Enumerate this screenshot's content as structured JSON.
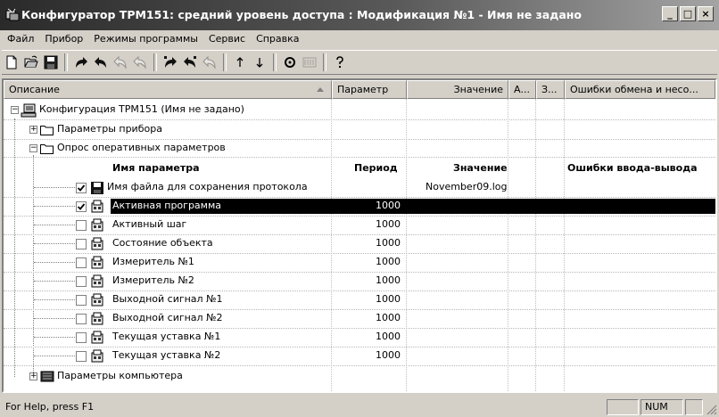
{
  "window": {
    "title": "Конфигуратор ТРМ151: средний уровень доступа : Модификация №1 - Имя не задано",
    "minimize": "_",
    "maximize": "□",
    "close": "×"
  },
  "menu": [
    {
      "label": "Файл"
    },
    {
      "label": "Прибор"
    },
    {
      "label": "Режимы программы"
    },
    {
      "label": "Сервис"
    },
    {
      "label": "Справка"
    }
  ],
  "toolbar": {
    "icons": [
      "new-file-icon",
      "open-folder-icon",
      "save-icon",
      "redo-arrow-icon",
      "undo-arrow-icon",
      "undo-outline-icon",
      "undo-outline-2-icon",
      "redo-arrow-2-icon",
      "undo-arrow-2-icon",
      "undo-outline-3-icon",
      "arrow-up-icon",
      "arrow-down-icon",
      "record-icon",
      "auto-icon",
      "help-icon"
    ]
  },
  "columns": {
    "description": "Описание",
    "parameter": "Параметр",
    "value": "Значение",
    "a": "А...",
    "z": "З...",
    "errors": "Ошибки обмена и несо..."
  },
  "tree": {
    "root": "Конфигурация ТРМ151 (Имя не задано)",
    "device_params": "Параметры прибора",
    "survey": "Опрос оперативных параметров",
    "computer_params": "Параметры компьютера"
  },
  "subtable": {
    "h_name": "Имя параметра",
    "h_period": "Период",
    "h_value": "Значение",
    "h_errors": "Ошибки ввода-вывода",
    "rows": [
      {
        "name": "Имя файла для сохранения протокола",
        "period": "",
        "value": "November09.log",
        "checked": true,
        "icon": "floppy-icon"
      },
      {
        "name": "Активная программа",
        "period": "1000",
        "value": "",
        "checked": true,
        "icon": "device-icon",
        "selected": true
      },
      {
        "name": "Активный шаг",
        "period": "1000",
        "value": "",
        "checked": false,
        "icon": "device-icon"
      },
      {
        "name": "Состояние объекта",
        "period": "1000",
        "value": "",
        "checked": false,
        "icon": "device-icon"
      },
      {
        "name": "Измеритель №1",
        "period": "1000",
        "value": "",
        "checked": false,
        "icon": "device-icon"
      },
      {
        "name": "Измеритель №2",
        "period": "1000",
        "value": "",
        "checked": false,
        "icon": "device-icon"
      },
      {
        "name": "Выходной сигнал №1",
        "period": "1000",
        "value": "",
        "checked": false,
        "icon": "device-icon"
      },
      {
        "name": "Выходной сигнал №2",
        "period": "1000",
        "value": "",
        "checked": false,
        "icon": "device-icon"
      },
      {
        "name": "Текущая уставка №1",
        "period": "1000",
        "value": "",
        "checked": false,
        "icon": "device-icon"
      },
      {
        "name": "Текущая уставка №2",
        "period": "1000",
        "value": "",
        "checked": false,
        "icon": "device-icon"
      }
    ]
  },
  "status": {
    "help": "For Help, press F1",
    "num": "NUM"
  }
}
